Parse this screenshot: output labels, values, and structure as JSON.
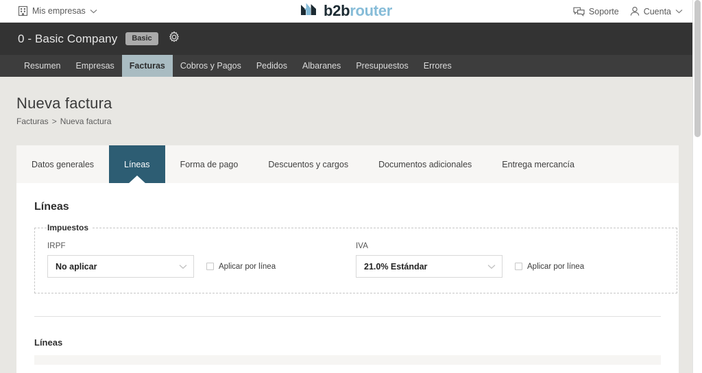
{
  "topbar": {
    "companies_label": "Mis empresas",
    "companies_icon": "building-icon",
    "logo_primary": "b2b",
    "logo_secondary": "router",
    "support_label": "Soporte",
    "support_icon": "chat-bubbles-icon",
    "account_label": "Cuenta",
    "account_icon": "user-icon",
    "caret_icon": "chevron-down-icon"
  },
  "company_header": {
    "name": "0 - Basic Company",
    "plan_badge": "Basic",
    "settings_icon": "gear-icon"
  },
  "nav": {
    "items": [
      {
        "label": "Resumen",
        "active": false
      },
      {
        "label": "Empresas",
        "active": false
      },
      {
        "label": "Facturas",
        "active": true
      },
      {
        "label": "Cobros y Pagos",
        "active": false
      },
      {
        "label": "Pedidos",
        "active": false
      },
      {
        "label": "Albaranes",
        "active": false
      },
      {
        "label": "Presupuestos",
        "active": false
      },
      {
        "label": "Errores",
        "active": false
      }
    ]
  },
  "page": {
    "title": "Nueva factura",
    "breadcrumb": {
      "parent": "Facturas",
      "separator": ">",
      "current": "Nueva factura"
    }
  },
  "card": {
    "tabs": [
      {
        "label": "Datos generales",
        "active": false
      },
      {
        "label": "Líneas",
        "active": true
      },
      {
        "label": "Forma de pago",
        "active": false
      },
      {
        "label": "Descuentos y cargos",
        "active": false
      },
      {
        "label": "Documentos adicionales",
        "active": false
      },
      {
        "label": "Entrega mercancía",
        "active": false
      }
    ],
    "section_title": "Líneas",
    "impuestos": {
      "legend": "Impuestos",
      "irpf": {
        "label": "IRPF",
        "value": "No aplicar",
        "caret_icon": "chevron-down-icon",
        "checkbox_label": "Aplicar por línea",
        "checked": false
      },
      "iva": {
        "label": "IVA",
        "value": "21.0% Estándar",
        "caret_icon": "chevron-down-icon",
        "checkbox_label": "Aplicar por línea",
        "checked": false
      }
    },
    "lines_subsection_title": "Líneas"
  },
  "colors": {
    "page_bg": "#e8e7e3",
    "company_bar": "#333333",
    "nav_bar": "#3d3d3d",
    "nav_active_bg": "#a9bcc2",
    "tab_active_bg": "#2d5d73",
    "card_bg": "#ffffff",
    "tabstrip_bg": "#f7f6f4",
    "logo_accent": "#7fb8d4"
  }
}
